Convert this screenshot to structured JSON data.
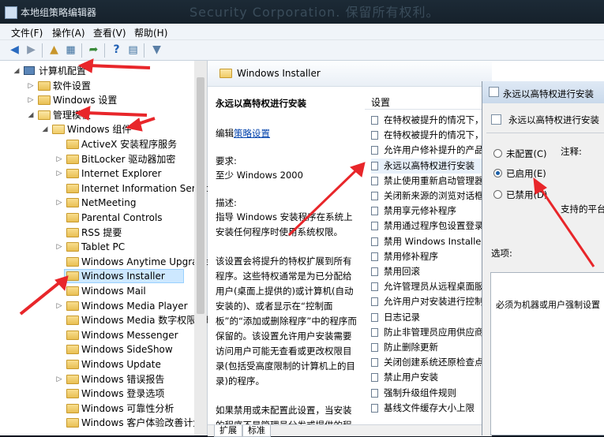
{
  "window": {
    "title": "本地组策略编辑器",
    "blurred_text": "Security Corporation. 保留所有权利。"
  },
  "menu": [
    "文件(F)",
    "操作(A)",
    "查看(V)",
    "帮助(H)"
  ],
  "toolbar_icons": [
    "back-arrow-icon",
    "forward-arrow-icon",
    "up-folder-icon",
    "show-tree-icon",
    "export-list-icon",
    "help-icon",
    "properties-icon",
    "filter-icon"
  ],
  "tree": [
    {
      "label": "计算机配置",
      "level": 0,
      "expand": "◢",
      "open": true,
      "icon": "computer-icon"
    },
    {
      "label": "软件设置",
      "level": 1,
      "expand": "▷"
    },
    {
      "label": "Windows 设置",
      "level": 1,
      "expand": "▷"
    },
    {
      "label": "管理模板",
      "level": 1,
      "expand": "◢",
      "open": true
    },
    {
      "label": "Windows 组件",
      "level": 2,
      "expand": "◢",
      "open": true
    },
    {
      "label": "ActiveX 安装程序服务",
      "level": 3,
      "expand": ""
    },
    {
      "label": "BitLocker 驱动器加密",
      "level": 3,
      "expand": "▷"
    },
    {
      "label": "Internet Explorer",
      "level": 3,
      "expand": "▷"
    },
    {
      "label": "Internet Information Services",
      "level": 3,
      "expand": ""
    },
    {
      "label": "NetMeeting",
      "level": 3,
      "expand": "▷"
    },
    {
      "label": "Parental Controls",
      "level": 3,
      "expand": ""
    },
    {
      "label": "RSS 提要",
      "level": 3,
      "expand": ""
    },
    {
      "label": "Tablet PC",
      "level": 3,
      "expand": "▷"
    },
    {
      "label": "Windows Anytime Upgrade",
      "level": 3,
      "expand": ""
    },
    {
      "label": "Windows Installer",
      "level": 3,
      "expand": "",
      "selected": true
    },
    {
      "label": "Windows Mail",
      "level": 3,
      "expand": ""
    },
    {
      "label": "Windows Media Player",
      "level": 3,
      "expand": "▷"
    },
    {
      "label": "Windows Media 数字权限管理",
      "level": 3,
      "expand": ""
    },
    {
      "label": "Windows Messenger",
      "level": 3,
      "expand": ""
    },
    {
      "label": "Windows SideShow",
      "level": 3,
      "expand": ""
    },
    {
      "label": "Windows Update",
      "level": 3,
      "expand": ""
    },
    {
      "label": "Windows 错误报告",
      "level": 3,
      "expand": "▷"
    },
    {
      "label": "Windows 登录选项",
      "level": 3,
      "expand": ""
    },
    {
      "label": "Windows 可靠性分析",
      "level": 3,
      "expand": ""
    },
    {
      "label": "Windows 客户体验改善计划",
      "level": 3,
      "expand": ""
    }
  ],
  "detail": {
    "header": "Windows Installer",
    "policy_title": "永远以高特权进行安装",
    "edit_prefix": "编辑",
    "edit_link": "策略设置",
    "req_label": "要求:",
    "req_value": "至少 Windows 2000",
    "desc_label": "描述:",
    "desc_p1": "指导 Windows 安装程序在系统上安装任何程序时使用系统权限。",
    "desc_p2": "该设置会将提升的特权扩展到所有程序。这些特权通常是为已分配给用户(桌面上提供的)或计算机(自动安装的)、或者显示在“控制面板”的“添加或删除程序”中的程序而保留的。该设置允许用户安装需要访问用户可能无查看或更改权限目录(包括受高度限制的计算机上的目录)的程序。",
    "desc_p3": "如果禁用或未配置此设置，当安装的程序不是管理员分发或提供的程序时，系统将会应用当前用户的权"
  },
  "settings": {
    "column_header": "设置",
    "items": [
      "在特权被提升的情况下，",
      "在特权被提升的情况下，",
      "允许用户修补提升的产品",
      "永远以高特权进行安装",
      "禁止使用重新启动管理器",
      "关闭新来源的浏览对话框",
      "禁用享元修补程序",
      "禁用通过程序包设置登录",
      "禁用 Windows Installer",
      "禁用修补程序",
      "禁用回滚",
      "允许管理员从远程桌面服",
      "允许用户对安装进行控制",
      "日志记录",
      "防止非管理员应用供应商",
      "防止删除更新",
      "关闭创建系统还原检查点",
      "禁止用户安装",
      "强制升级组件规则",
      "基线文件缓存大小上限"
    ],
    "highlight_index": 3
  },
  "tabs": [
    "扩展",
    "标准"
  ],
  "dialog": {
    "title": "永远以高特权进行安装",
    "subtitle": "永远以高特权进行安装",
    "radios": [
      {
        "label": "未配置(C)",
        "checked": false
      },
      {
        "label": "已启用(E)",
        "checked": true
      },
      {
        "label": "已禁用(D)",
        "checked": false
      }
    ],
    "note_label": "注释:",
    "platform_label": "支持的平台",
    "options_label": "选项:",
    "help_text": "必须为机器或用户强制设置"
  },
  "colors": {
    "annotation_arrow": "#e8262a",
    "selection": "#cde8ff",
    "folder": "#f0c75e"
  }
}
